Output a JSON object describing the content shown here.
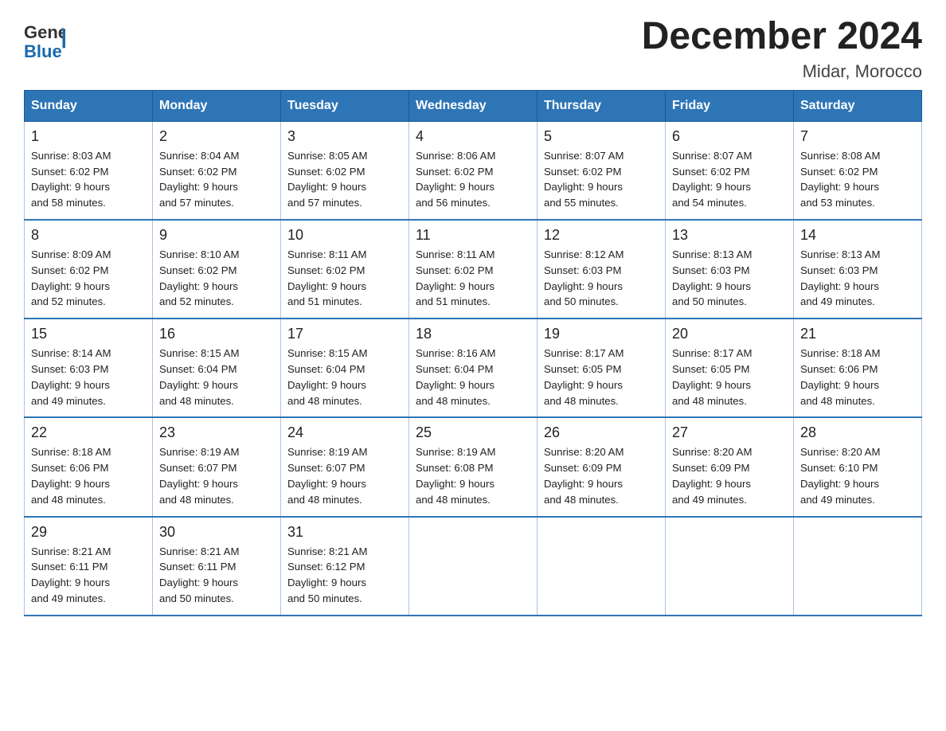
{
  "header": {
    "logo_general": "General",
    "logo_blue": "Blue",
    "title": "December 2024",
    "location": "Midar, Morocco"
  },
  "days_of_week": [
    "Sunday",
    "Monday",
    "Tuesday",
    "Wednesday",
    "Thursday",
    "Friday",
    "Saturday"
  ],
  "weeks": [
    [
      {
        "day": "1",
        "sunrise": "8:03 AM",
        "sunset": "6:02 PM",
        "daylight": "9 hours and 58 minutes."
      },
      {
        "day": "2",
        "sunrise": "8:04 AM",
        "sunset": "6:02 PM",
        "daylight": "9 hours and 57 minutes."
      },
      {
        "day": "3",
        "sunrise": "8:05 AM",
        "sunset": "6:02 PM",
        "daylight": "9 hours and 57 minutes."
      },
      {
        "day": "4",
        "sunrise": "8:06 AM",
        "sunset": "6:02 PM",
        "daylight": "9 hours and 56 minutes."
      },
      {
        "day": "5",
        "sunrise": "8:07 AM",
        "sunset": "6:02 PM",
        "daylight": "9 hours and 55 minutes."
      },
      {
        "day": "6",
        "sunrise": "8:07 AM",
        "sunset": "6:02 PM",
        "daylight": "9 hours and 54 minutes."
      },
      {
        "day": "7",
        "sunrise": "8:08 AM",
        "sunset": "6:02 PM",
        "daylight": "9 hours and 53 minutes."
      }
    ],
    [
      {
        "day": "8",
        "sunrise": "8:09 AM",
        "sunset": "6:02 PM",
        "daylight": "9 hours and 52 minutes."
      },
      {
        "day": "9",
        "sunrise": "8:10 AM",
        "sunset": "6:02 PM",
        "daylight": "9 hours and 52 minutes."
      },
      {
        "day": "10",
        "sunrise": "8:11 AM",
        "sunset": "6:02 PM",
        "daylight": "9 hours and 51 minutes."
      },
      {
        "day": "11",
        "sunrise": "8:11 AM",
        "sunset": "6:02 PM",
        "daylight": "9 hours and 51 minutes."
      },
      {
        "day": "12",
        "sunrise": "8:12 AM",
        "sunset": "6:03 PM",
        "daylight": "9 hours and 50 minutes."
      },
      {
        "day": "13",
        "sunrise": "8:13 AM",
        "sunset": "6:03 PM",
        "daylight": "9 hours and 50 minutes."
      },
      {
        "day": "14",
        "sunrise": "8:13 AM",
        "sunset": "6:03 PM",
        "daylight": "9 hours and 49 minutes."
      }
    ],
    [
      {
        "day": "15",
        "sunrise": "8:14 AM",
        "sunset": "6:03 PM",
        "daylight": "9 hours and 49 minutes."
      },
      {
        "day": "16",
        "sunrise": "8:15 AM",
        "sunset": "6:04 PM",
        "daylight": "9 hours and 48 minutes."
      },
      {
        "day": "17",
        "sunrise": "8:15 AM",
        "sunset": "6:04 PM",
        "daylight": "9 hours and 48 minutes."
      },
      {
        "day": "18",
        "sunrise": "8:16 AM",
        "sunset": "6:04 PM",
        "daylight": "9 hours and 48 minutes."
      },
      {
        "day": "19",
        "sunrise": "8:17 AM",
        "sunset": "6:05 PM",
        "daylight": "9 hours and 48 minutes."
      },
      {
        "day": "20",
        "sunrise": "8:17 AM",
        "sunset": "6:05 PM",
        "daylight": "9 hours and 48 minutes."
      },
      {
        "day": "21",
        "sunrise": "8:18 AM",
        "sunset": "6:06 PM",
        "daylight": "9 hours and 48 minutes."
      }
    ],
    [
      {
        "day": "22",
        "sunrise": "8:18 AM",
        "sunset": "6:06 PM",
        "daylight": "9 hours and 48 minutes."
      },
      {
        "day": "23",
        "sunrise": "8:19 AM",
        "sunset": "6:07 PM",
        "daylight": "9 hours and 48 minutes."
      },
      {
        "day": "24",
        "sunrise": "8:19 AM",
        "sunset": "6:07 PM",
        "daylight": "9 hours and 48 minutes."
      },
      {
        "day": "25",
        "sunrise": "8:19 AM",
        "sunset": "6:08 PM",
        "daylight": "9 hours and 48 minutes."
      },
      {
        "day": "26",
        "sunrise": "8:20 AM",
        "sunset": "6:09 PM",
        "daylight": "9 hours and 48 minutes."
      },
      {
        "day": "27",
        "sunrise": "8:20 AM",
        "sunset": "6:09 PM",
        "daylight": "9 hours and 49 minutes."
      },
      {
        "day": "28",
        "sunrise": "8:20 AM",
        "sunset": "6:10 PM",
        "daylight": "9 hours and 49 minutes."
      }
    ],
    [
      {
        "day": "29",
        "sunrise": "8:21 AM",
        "sunset": "6:11 PM",
        "daylight": "9 hours and 49 minutes."
      },
      {
        "day": "30",
        "sunrise": "8:21 AM",
        "sunset": "6:11 PM",
        "daylight": "9 hours and 50 minutes."
      },
      {
        "day": "31",
        "sunrise": "8:21 AM",
        "sunset": "6:12 PM",
        "daylight": "9 hours and 50 minutes."
      },
      null,
      null,
      null,
      null
    ]
  ],
  "labels": {
    "sunrise": "Sunrise:",
    "sunset": "Sunset:",
    "daylight": "Daylight:"
  }
}
